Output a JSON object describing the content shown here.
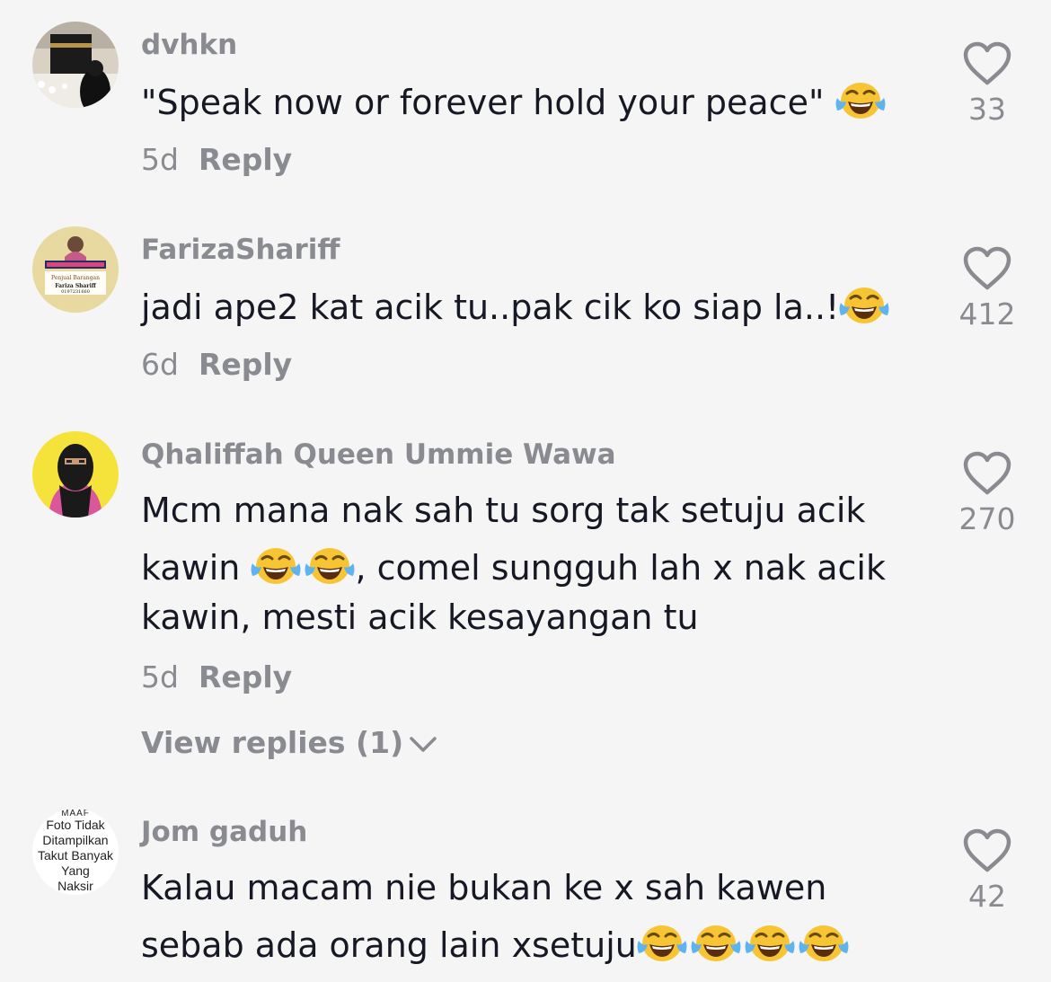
{
  "comments": [
    {
      "username": "dvhkn",
      "text_parts": [
        "\"Speak now or forever hold your peace\" "
      ],
      "time": "5d",
      "reply_label": "Reply",
      "likes": "33",
      "emoji_count": 1
    },
    {
      "username": "FarizaShariff",
      "text_parts": [
        "jadi ape2 kat acik tu..pak cik ko siap la..!"
      ],
      "time": "6d",
      "reply_label": "Reply",
      "likes": "412",
      "avatar_lines": [
        "Penjual Barangan",
        "Fariza Shariff",
        "0197231660"
      ],
      "emoji_count": 1
    },
    {
      "username": "Qhaliffah Queen Ummie Wawa",
      "text_parts": [
        "Mcm mana nak sah tu sorg tak setuju acik",
        "kawin ",
        ", comel sungguh lah x nak acik",
        "kawin, mesti acik kesayangan tu"
      ],
      "time": "5d",
      "reply_label": "Reply",
      "likes": "270",
      "view_replies": "View replies (1)",
      "emoji_count": 2
    },
    {
      "username": "Jom gaduh",
      "text_parts": [
        "Kalau macam nie bukan ke x sah kawen",
        "sebab ada orang lain xsetuju"
      ],
      "likes": "42",
      "avatar_lines": [
        "MAAF",
        "Foto Tidak",
        "Ditampilkan",
        "Takut Banyak",
        "Yang",
        "Naksir"
      ],
      "emoji_count": 4
    }
  ],
  "colors": {
    "background": "#f5f5f6",
    "primary_text": "#161823",
    "secondary_text": "#8a8b91"
  },
  "icons": {
    "like": "heart-outline-icon",
    "expand": "chevron-down-icon",
    "emoji": "face-with-tears-of-joy"
  }
}
